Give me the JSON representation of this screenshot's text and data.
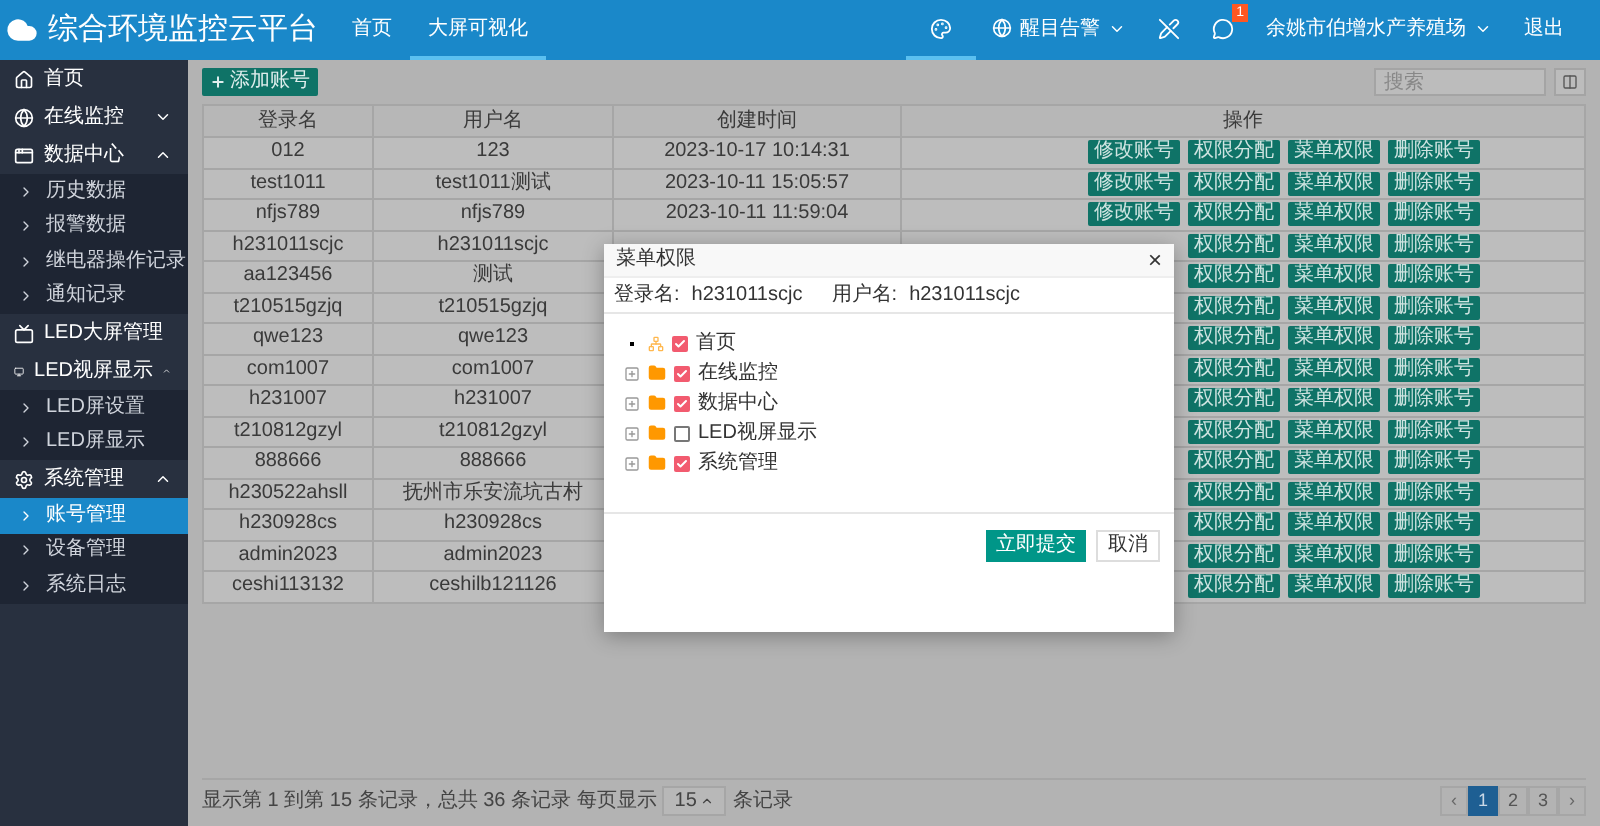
{
  "header": {
    "title": "综合环境监控云平台",
    "nav": [
      {
        "label": "首页",
        "selected": false
      },
      {
        "label": "大屏可视化",
        "selected": true
      }
    ],
    "tools": [
      {
        "kind": "palette",
        "selected": true
      },
      {
        "kind": "alarm",
        "label": "醒目告警",
        "selected": false
      },
      {
        "kind": "pen",
        "selected": false
      },
      {
        "kind": "message",
        "badge": "1",
        "selected": false
      },
      {
        "kind": "company",
        "label": "余姚市伯增水产养殖场",
        "selected": false
      },
      {
        "kind": "logout",
        "label": "退出",
        "selected": false
      }
    ]
  },
  "sidebar": {
    "items": [
      {
        "label": "首页",
        "selected": false
      },
      {
        "label": "在线监控",
        "expanded": false,
        "selected": false
      },
      {
        "label": "数据中心",
        "expanded": true,
        "selected": false,
        "children": [
          {
            "label": "历史数据",
            "selected": false
          },
          {
            "label": "报警数据",
            "selected": false
          },
          {
            "label": "继电器操作记录",
            "selected": false
          },
          {
            "label": "通知记录",
            "selected": false
          }
        ]
      },
      {
        "label": "LED大屏管理",
        "selected": false
      },
      {
        "label": "LED视屏显示",
        "expanded": true,
        "selected": false,
        "children": [
          {
            "label": "LED屏设置",
            "selected": false
          },
          {
            "label": "LED屏显示",
            "selected": false
          }
        ]
      },
      {
        "label": "系统管理",
        "expanded": true,
        "selected": false,
        "children": [
          {
            "label": "账号管理",
            "selected": true
          },
          {
            "label": "设备管理",
            "selected": false
          },
          {
            "label": "系统日志",
            "selected": false
          }
        ]
      }
    ]
  },
  "toolbar": {
    "add_button": "添加账号",
    "search": {
      "placeholder": "搜索"
    }
  },
  "table": {
    "columns": [
      "登录名",
      "用户名",
      "创建时间",
      "操作"
    ],
    "rows": [
      {
        "login": "012",
        "user": "123",
        "created": "2023-10-17 10:14:31",
        "actions": [
          "修改账号",
          "权限分配",
          "菜单权限",
          "删除账号"
        ]
      },
      {
        "login": "test1011",
        "user": "test1011测试",
        "created": "2023-10-11 15:05:57",
        "actions": [
          "修改账号",
          "权限分配",
          "菜单权限",
          "删除账号"
        ]
      },
      {
        "login": "nfjs789",
        "user": "nfjs789",
        "created": "2023-10-11 11:59:04",
        "actions": [
          "修改账号",
          "权限分配",
          "菜单权限",
          "删除账号"
        ]
      },
      {
        "login": "h231011scjc",
        "user": "h231011scjc",
        "actions": [
          "权限分配",
          "菜单权限",
          "删除账号"
        ]
      },
      {
        "login": "aa123456",
        "user": "测试",
        "actions": [
          "权限分配",
          "菜单权限",
          "删除账号"
        ]
      },
      {
        "login": "t210515gzjq",
        "user": "t210515gzjq",
        "actions": [
          "权限分配",
          "菜单权限",
          "删除账号"
        ]
      },
      {
        "login": "qwe123",
        "user": "qwe123",
        "actions": [
          "权限分配",
          "菜单权限",
          "删除账号"
        ]
      },
      {
        "login": "com1007",
        "user": "com1007",
        "actions": [
          "权限分配",
          "菜单权限",
          "删除账号"
        ]
      },
      {
        "login": "h231007",
        "user": "h231007",
        "actions": [
          "权限分配",
          "菜单权限",
          "删除账号"
        ]
      },
      {
        "login": "t210812gzyl",
        "user": "t210812gzyl",
        "actions": [
          "权限分配",
          "菜单权限",
          "删除账号"
        ]
      },
      {
        "login": "888666",
        "user": "888666",
        "actions": [
          "权限分配",
          "菜单权限",
          "删除账号"
        ]
      },
      {
        "login": "h230522ahsll",
        "user": "抚州市乐安流坑古村",
        "actions": [
          "权限分配",
          "菜单权限",
          "删除账号"
        ]
      },
      {
        "login": "h230928cs",
        "user": "h230928cs",
        "actions": [
          "权限分配",
          "菜单权限",
          "删除账号"
        ]
      },
      {
        "login": "admin2023",
        "user": "admin2023",
        "actions": [
          "权限分配",
          "菜单权限",
          "删除账号"
        ]
      },
      {
        "login": "ceshi113132",
        "user": "ceshilb121126",
        "actions": [
          "权限分配",
          "菜单权限",
          "删除账号"
        ]
      }
    ]
  },
  "pagination": {
    "summary": "显示第 1 到第 15 条记录，总共 36 条记录 每页显示",
    "page_size": "15",
    "suffix": "条记录",
    "prev": "‹",
    "pages": [
      {
        "label": "1",
        "selected": true
      },
      {
        "label": "2",
        "selected": false
      },
      {
        "label": "3",
        "selected": false
      }
    ],
    "next": "›"
  },
  "dialog": {
    "title": "菜单权限",
    "close": "×",
    "login_label": "登录名:",
    "login": "h231011scjc",
    "user_label": "用户名:",
    "user": "h231011scjc",
    "tree": [
      {
        "kind": "leaf",
        "label": "首页",
        "checked": true
      },
      {
        "kind": "folder",
        "label": "在线监控",
        "checked": true,
        "expanded": false
      },
      {
        "kind": "folder",
        "label": "数据中心",
        "checked": true,
        "expanded": false
      },
      {
        "kind": "folder",
        "label": "LED视屏显示",
        "checked": false,
        "expanded": false
      },
      {
        "kind": "folder",
        "label": "系统管理",
        "checked": true,
        "expanded": false
      }
    ],
    "buttons": [
      {
        "kind": "primary",
        "label": "立即提交"
      },
      {
        "kind": "secondary",
        "label": "取消"
      }
    ]
  }
}
